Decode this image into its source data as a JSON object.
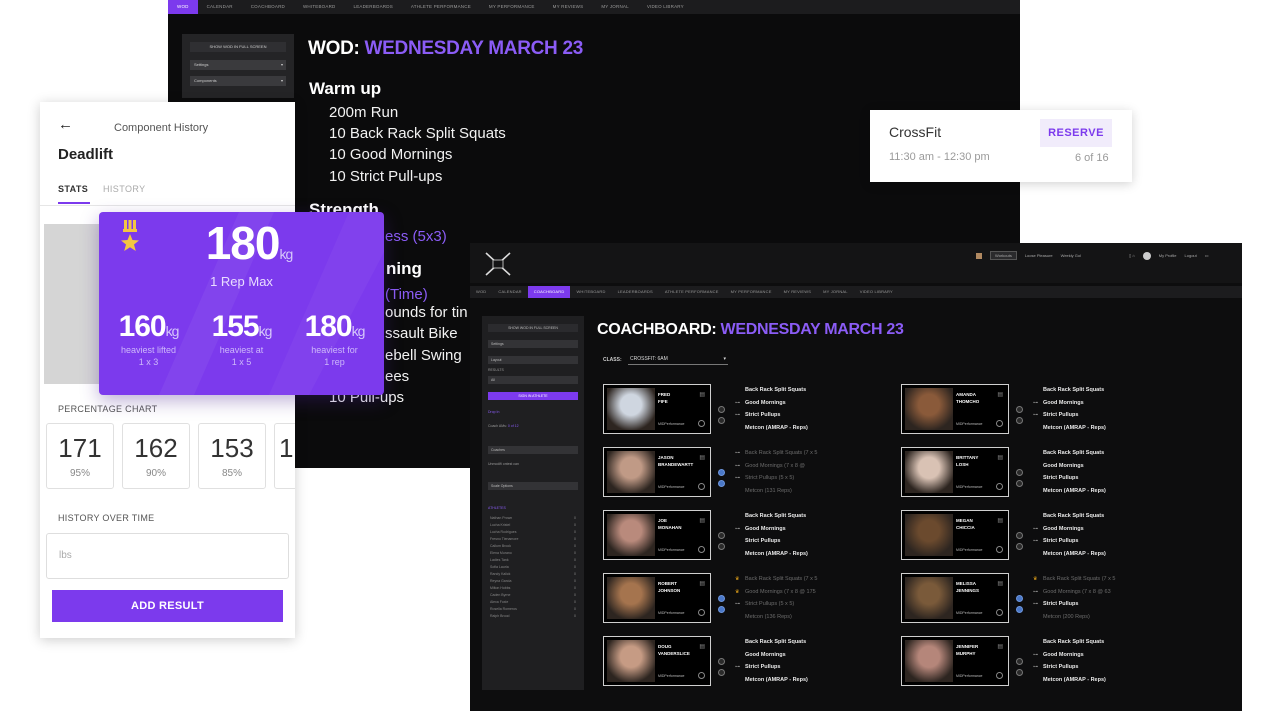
{
  "wod": {
    "nav": [
      "WOD",
      "CALENDAR",
      "COACHBOARD",
      "WHITEBOARD",
      "LEADERBOARDS",
      "ATHLETE PERFORMANCE",
      "MY PERFORMANCE",
      "MY REVIEWS",
      "MY JORNAL",
      "VIDEO LIBRARY"
    ],
    "sidebar": {
      "show_button": "SHOW WOD IN FULL SCREEN",
      "select1": "Settings",
      "select2": "Components"
    },
    "title_prefix": "WOD:",
    "title_date": "WEDNESDAY MARCH 23",
    "warmup_heading": "Warm up",
    "warmup": [
      "200m Run",
      "10 Back Rack Split Squats",
      "10 Good Mornings",
      "10 Strict Pull-ups"
    ],
    "strength_heading": "Strength",
    "strength_line": "ess (5x3)",
    "cond_heading": "ning",
    "cond_lines": [
      "(Time)",
      "ounds for tin",
      "ssault Bike",
      "ebell Swing",
      "ees",
      "10 Pull-ups"
    ]
  },
  "reserve_card": {
    "title": "CrossFit",
    "time": "11:30 am - 12:30 pm",
    "button": "RESERVE",
    "spots": "6 of 16"
  },
  "mobile": {
    "back_icon": "←",
    "header": "Component History",
    "lift": "Deadlift",
    "tabs": [
      "STATS",
      "HISTORY"
    ],
    "percentage_label": "PERCENTAGE CHART",
    "percentages": [
      {
        "value": "171",
        "pct": "95%"
      },
      {
        "value": "162",
        "pct": "90%"
      },
      {
        "value": "153",
        "pct": "85%"
      },
      {
        "value": "1",
        "pct": ""
      }
    ],
    "history_label": "HISTORY OVER TIME",
    "input_placeholder": "lbs",
    "add_button": "ADD RESULT"
  },
  "stats": {
    "max": "180",
    "unit": "kg",
    "max_label": "1 Rep Max",
    "items": [
      {
        "value": "160",
        "l1": "heaviest lifted",
        "l2": "1 x 3"
      },
      {
        "value": "155",
        "l1": "heaviest at",
        "l2": "1 x 5"
      },
      {
        "value": "180",
        "l1": "heaviest for",
        "l2": "1 rep"
      }
    ]
  },
  "coach": {
    "nav": [
      "WOD",
      "CALENDAR",
      "COACHBOARD",
      "WHITEBOARD",
      "LEADERBOARDS",
      "ATHLETE PERFORMANCE",
      "MY PERFORMANCE",
      "MY REVIEWS",
      "MY JORNAL",
      "VIDEO LIBRARY"
    ],
    "user_links": [
      "Workouts",
      "Loose Pleasure",
      "Weekly Gol",
      "My Profile",
      "Logout"
    ],
    "title_prefix": "COACHBOARD:",
    "title_date": "WEDNESDAY MARCH 23",
    "class_label": "CLASS:",
    "class_value": "CROSSFIT: 6AM",
    "sidebar": {
      "show_button": "SHOW WOD IN FULL SCREEN",
      "selects": [
        "Settings",
        "Layout",
        "All"
      ],
      "results_label": "RESULTS",
      "sign_in": "SIGN IN ATHLETE",
      "link1": "Drop In",
      "count_text": "Coach AMs:",
      "count_value": "0 of 12",
      "select_coaches": "Coaches",
      "label_unlocked": "Unmodifi ontest can",
      "select_scale": "Scale Options",
      "athletes_label": "ATHLETES",
      "athletes": [
        "Nathan Prown",
        "Lucha Kristel",
        "Lucha Rodrigues",
        "Fresno Tienamore",
        "Callum Brook",
        "Elena Murano",
        "Ladies Tank",
        "Sofia Lauria",
        "Randy Kalick",
        "Reyna Garcia",
        "Milton Hobbs",
        "Caden Byrne",
        "Alexa Foxie",
        "Rosella Romeros",
        "Ralph Brood"
      ],
      "athlete_counts": [
        "0",
        "0",
        "0",
        "0",
        "0",
        "0",
        "0",
        "0",
        "0",
        "0",
        "0",
        "0",
        "0",
        "0",
        "0"
      ]
    },
    "athletes": [
      {
        "name1": "FRED",
        "name2": "FIFE",
        "perf": "MIDPerformance",
        "workouts": [
          [
            "Back Rack Split Squats",
            "",
            ""
          ],
          [
            "Good Mornings",
            "",
            "wt"
          ],
          [
            "Strict Pullups",
            "",
            "wt"
          ],
          [
            "Metcon (AMRAP - Reps)",
            "",
            ""
          ]
        ]
      },
      {
        "name1": "AMANDA",
        "name2": "THOMCHO",
        "perf": "MIDPerformance",
        "workouts": [
          [
            "Back Rack Split Squats",
            "",
            ""
          ],
          [
            "Good Mornings",
            "",
            "wt"
          ],
          [
            "Strict Pullups",
            "",
            "wt"
          ],
          [
            "Metcon (AMRAP - Reps)",
            "",
            ""
          ]
        ]
      },
      {
        "name1": "JASON",
        "name2": "BRANDEWARTT",
        "perf": "MIDPerformance",
        "workouts": [
          [
            "Back Rack Split Squats (7 x 5",
            "dim",
            "wt"
          ],
          [
            "Good Mornings (7 x 8 @",
            "dim",
            "wt"
          ],
          [
            "Strict Pullups (5 x 5)",
            "dim",
            "wt"
          ],
          [
            "Metcon (131 Reps)",
            "dim",
            ""
          ]
        ]
      },
      {
        "name1": "BRITTANY",
        "name2": "LOSH",
        "perf": "MIDPerformance",
        "workouts": [
          [
            "Back Rack Split Squats",
            "",
            ""
          ],
          [
            "Good Mornings",
            "",
            ""
          ],
          [
            "Strict Pullups",
            "",
            ""
          ],
          [
            "Metcon (AMRAP - Reps)",
            "",
            ""
          ]
        ]
      },
      {
        "name1": "JOE",
        "name2": "MONAHAN",
        "perf": "MIDPerformance",
        "workouts": [
          [
            "Back Rack Split Squats",
            "",
            ""
          ],
          [
            "Good Mornings",
            "",
            "wt"
          ],
          [
            "Strict Pullups",
            "",
            ""
          ],
          [
            "Metcon (AMRAP - Reps)",
            "",
            ""
          ]
        ]
      },
      {
        "name1": "MEGAN",
        "name2": "CHICCIA",
        "perf": "MIDPerformance",
        "workouts": [
          [
            "Back Rack Split Squats",
            "",
            ""
          ],
          [
            "Good Mornings",
            "",
            "wt"
          ],
          [
            "Strict Pullups",
            "",
            "wt"
          ],
          [
            "Metcon (AMRAP - Reps)",
            "",
            ""
          ]
        ]
      },
      {
        "name1": "ROBERT",
        "name2": "JOHNSON",
        "perf": "MIDPerformance",
        "workouts": [
          [
            "Back Rack Split Squats (7 x 5",
            "dim",
            "gold"
          ],
          [
            "Good Mornings (7 x 8 @ 175",
            "dim",
            "gold"
          ],
          [
            "Strict Pullups (5 x 5)",
            "dim",
            "wt"
          ],
          [
            "Metcon (136 Reps)",
            "dim",
            ""
          ]
        ]
      },
      {
        "name1": "MELISSA",
        "name2": "JENNINGS",
        "perf": "MIDPerformance",
        "workouts": [
          [
            "Back Rack Split Squats (7 x 5",
            "dim",
            "gold"
          ],
          [
            "Good Mornings (7 x 8 @ 63",
            "dim",
            "wt"
          ],
          [
            "Strict Pullups",
            "",
            "wt"
          ],
          [
            "Metcon (200 Reps)",
            "dim",
            ""
          ]
        ]
      },
      {
        "name1": "DOUG",
        "name2": "VANDERSLICE",
        "perf": "MIDPerformance",
        "workouts": [
          [
            "Back Rack Split Squats",
            "",
            ""
          ],
          [
            "Good Mornings",
            "",
            ""
          ],
          [
            "Strict Pullups",
            "",
            "wt"
          ],
          [
            "Metcon (AMRAP - Reps)",
            "",
            ""
          ]
        ]
      },
      {
        "name1": "JENNIFER",
        "name2": "MURPHY",
        "perf": "MIDPerformance",
        "workouts": [
          [
            "Back Rack Split Squats",
            "",
            ""
          ],
          [
            "Good Mornings",
            "",
            "wt"
          ],
          [
            "Strict Pullups",
            "",
            "wt"
          ],
          [
            "Metcon (AMRAP - Reps)",
            "",
            ""
          ]
        ]
      }
    ]
  }
}
